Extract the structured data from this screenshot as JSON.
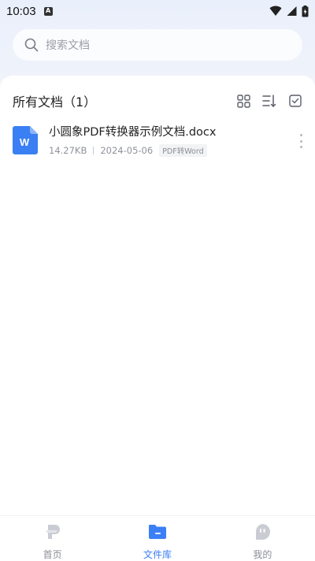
{
  "status_bar": {
    "time": "10:03",
    "notification_glyph": "A"
  },
  "search": {
    "placeholder": "搜索文档"
  },
  "section": {
    "title": "所有文档（1）"
  },
  "header_tools": [
    "grid-view-icon",
    "sort-icon",
    "select-checkbox-icon"
  ],
  "documents": [
    {
      "name": "小圆象PDF转换器示例文档.docx",
      "size": "14.27KB",
      "date": "2024-05-06",
      "tag": "PDF转Word",
      "icon": "word-doc-icon",
      "icon_letter": "W"
    }
  ],
  "bottom_nav": [
    {
      "label": "首页",
      "icon": "home-logo-icon",
      "active": false
    },
    {
      "label": "文件库",
      "icon": "folder-icon",
      "active": true
    },
    {
      "label": "我的",
      "icon": "profile-chat-icon",
      "active": false
    }
  ],
  "colors": {
    "accent": "#3b7ff6",
    "word_blue": "#3a7ff3",
    "inactive_icon": "#c9ccd3"
  }
}
